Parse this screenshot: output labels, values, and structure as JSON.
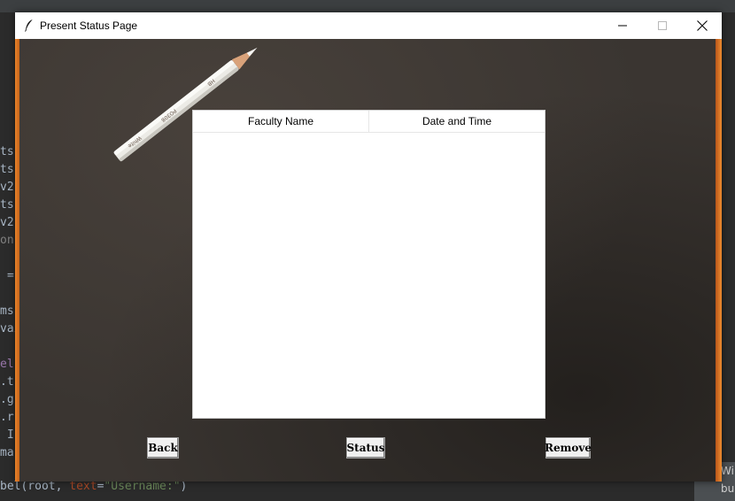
{
  "window": {
    "title": "Present Status Page"
  },
  "table": {
    "columns": [
      "Faculty Name",
      "Date and Time"
    ],
    "rows": []
  },
  "buttons": {
    "back": "Back",
    "status": "Status",
    "remove": "Remove"
  },
  "background_ide": {
    "left_fragments": [
      "ts",
      "ts",
      "v2",
      "ts",
      "v2",
      "on",
      "=",
      "ms",
      "vai",
      "el",
      ".t",
      ".g",
      ".r",
      "I",
      "ma"
    ],
    "code_line_prefix": "bel(root, ",
    "code_line_kw": "text",
    "code_line_eq": "=",
    "code_line_str": "\"Username:\"",
    "code_line_suffix": ")",
    "tooltip_line1": "Wi",
    "tooltip_line2": "bu"
  },
  "colors": {
    "accent_orange": "#e8822a",
    "background_dark": "#3a3531",
    "table_bg": "#ffffff"
  }
}
